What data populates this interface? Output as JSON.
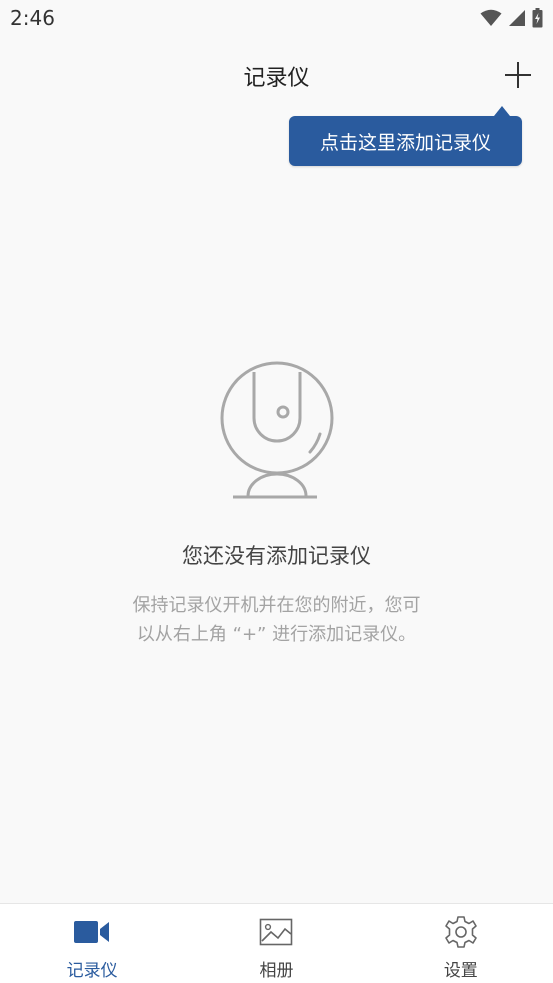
{
  "status_bar": {
    "time": "2:46"
  },
  "app_bar": {
    "title": "记录仪"
  },
  "tooltip": {
    "text": "点击这里添加记录仪"
  },
  "empty_state": {
    "title": "您还没有添加记录仪",
    "description_line1": "保持记录仪开机并在您的附近，您可",
    "description_line2": "以从右上角 “+” 进行添加记录仪。"
  },
  "bottom_nav": {
    "items": [
      {
        "label": "记录仪",
        "icon": "video-camera-icon",
        "active": true
      },
      {
        "label": "相册",
        "icon": "image-icon",
        "active": false
      },
      {
        "label": "设置",
        "icon": "gear-icon",
        "active": false
      }
    ]
  },
  "colors": {
    "accent": "#2a5b9e",
    "background": "#f9f9f9",
    "muted_text": "#a3a3a3"
  }
}
